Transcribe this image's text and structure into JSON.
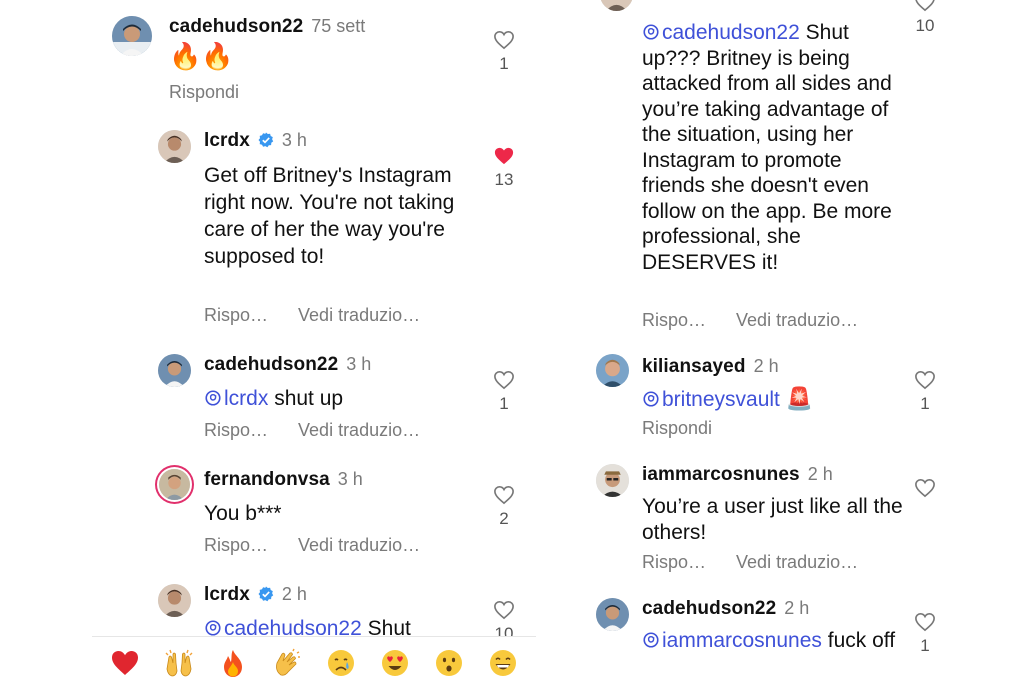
{
  "colors": {
    "mention": "#3f51d8",
    "like_active": "#ed2849",
    "muted": "#7a7a7a",
    "verified": "#3897f0"
  },
  "left": {
    "c1": {
      "username": "cadehudson22",
      "time": "75 sett",
      "text": "🔥🔥",
      "reply": "Rispondi",
      "likes": "1"
    },
    "c2": {
      "username": "lcrdx",
      "time": "3 h",
      "text": "Get off Britney's Instagram right now. You're not taking care of her the way you're supposed to!",
      "reply": "Rispo…",
      "translate": "Vedi traduzio…",
      "likes": "13",
      "liked": true
    },
    "c3": {
      "username": "cadehudson22",
      "time": "3 h",
      "mention": "lcrdx",
      "text": "shut up",
      "reply": "Rispo…",
      "translate": "Vedi traduzio…",
      "likes": "1"
    },
    "c4": {
      "username": "fernandonvsa",
      "time": "3 h",
      "text": "You b***",
      "reply": "Rispo…",
      "translate": "Vedi traduzio…",
      "likes": "2"
    },
    "c5": {
      "username": "lcrdx",
      "time": "2 h",
      "mention": "cadehudson22",
      "text": "Shut",
      "likes": "10"
    }
  },
  "right": {
    "c1": {
      "mention": "cadehudson22",
      "text": "Shut up??? Britney is being attacked from all sides and you’re taking advantage of the situation, using her Instagram to promote friends she doesn't even follow on the app. Be more professional, she DESERVES it!",
      "reply": "Rispo…",
      "translate": "Vedi traduzio…",
      "likes": "10"
    },
    "c2": {
      "username": "kiliansayed",
      "time": "2 h",
      "mention": "britneysvault",
      "text": "🚨",
      "reply": "Rispondi",
      "likes": "1"
    },
    "c3": {
      "username": "iammarcosnunes",
      "time": "2 h",
      "text": "You’re a user just like all the others!",
      "reply": "Rispo…",
      "translate": "Vedi traduzio…"
    },
    "c4": {
      "username": "cadehudson22",
      "time": "2 h",
      "mention": "iammarcosnunes",
      "text": "fuck off",
      "likes": "1"
    }
  },
  "reactions": [
    "heart",
    "raised-hands",
    "fire",
    "clapping-hands",
    "crying-face",
    "heart-eyes-face",
    "surprised-face",
    "grinning-face"
  ]
}
